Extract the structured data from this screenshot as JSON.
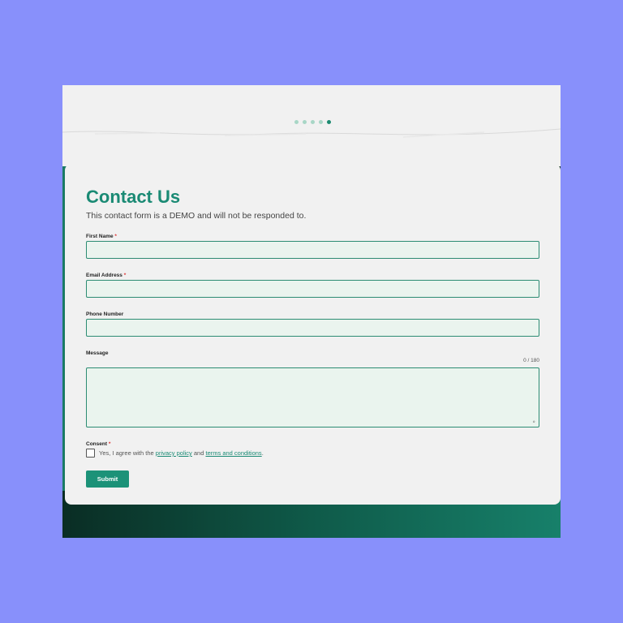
{
  "slider": {
    "dot_count": 5,
    "active_index": 4
  },
  "form": {
    "title": "Contact Us",
    "subtitle": "This contact form is a DEMO and will not be responded to.",
    "required_marker": "*",
    "fields": {
      "first_name": {
        "label": "First Name",
        "value": "",
        "required": true
      },
      "email": {
        "label": "Email Address",
        "value": "",
        "required": true
      },
      "phone": {
        "label": "Phone Number",
        "value": "",
        "required": false
      },
      "message": {
        "label": "Message",
        "value": "",
        "counter": "0 / 180"
      }
    },
    "consent": {
      "label": "Consent",
      "text_before": "Yes, I agree with the ",
      "privacy_link": "privacy policy",
      "text_middle": " and ",
      "terms_link": "terms and conditions",
      "text_after": ".",
      "checked": false
    },
    "submit_label": "Submit"
  },
  "colors": {
    "page_background": "#8890fb",
    "accent": "#1a8a74",
    "button": "#1c9278",
    "field_background": "#eaf4ee",
    "required": "#dd3333"
  }
}
